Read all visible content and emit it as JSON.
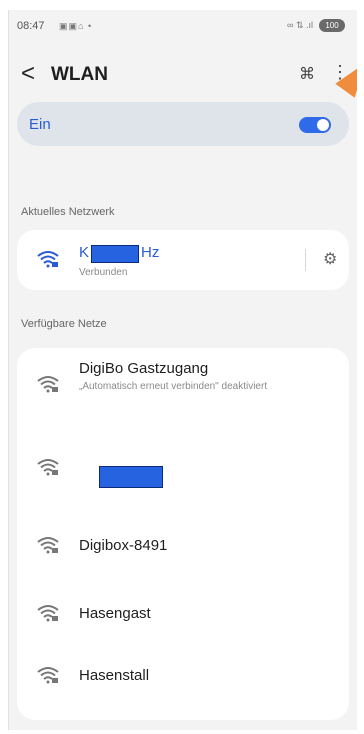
{
  "status_bar": {
    "time": "08:47",
    "icons": "▣▣⌂ •",
    "signal": "∞ ⇅ .ıl",
    "battery": "100"
  },
  "header": {
    "title": "WLAN"
  },
  "wifi_toggle": {
    "label": "Ein",
    "state": "on"
  },
  "current": {
    "section_label": "Aktuelles Netzwerk",
    "name_prefix": "K",
    "name_suffix": "Hz",
    "status": "Verbunden"
  },
  "available": {
    "section_label": "Verfügbare Netze",
    "networks": [
      {
        "name": "DigiBo Gastzugang",
        "sub": "„Automatisch erneut verbinden\" deaktiviert"
      },
      {
        "name": ""
      },
      {
        "name": "Digibox-8491"
      },
      {
        "name": "Hasengast"
      },
      {
        "name": "Hasenstall"
      }
    ]
  },
  "colors": {
    "accent": "#2a5bd7",
    "toggle": "#2f6be8",
    "annotation_arrow": "#f08d3c",
    "redaction": "#2563e0"
  }
}
